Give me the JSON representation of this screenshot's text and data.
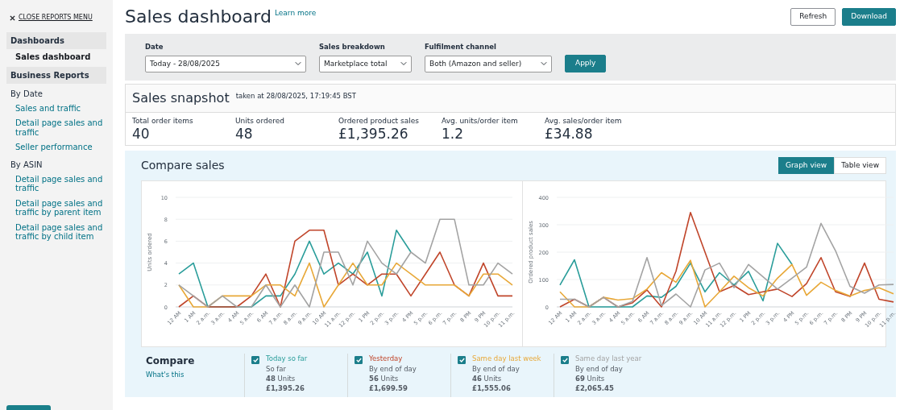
{
  "sidebar": {
    "close_label": "CLOSE REPORTS MENU",
    "items": [
      {
        "kind": "header",
        "label": "Dashboards"
      },
      {
        "kind": "link",
        "label": "Sales dashboard",
        "selected": true
      },
      {
        "kind": "header",
        "label": "Business Reports"
      },
      {
        "kind": "group",
        "label": "By Date"
      },
      {
        "kind": "link",
        "label": "Sales and traffic",
        "selected": false
      },
      {
        "kind": "link",
        "label": "Detail page sales and traffic",
        "selected": false
      },
      {
        "kind": "link",
        "label": "Seller performance",
        "selected": false
      },
      {
        "kind": "group",
        "label": "By ASIN"
      },
      {
        "kind": "link",
        "label": "Detail page sales and traffic",
        "selected": false
      },
      {
        "kind": "link",
        "label": "Detail page sales and traffic by parent item",
        "selected": false
      },
      {
        "kind": "link",
        "label": "Detail page sales and traffic by child item",
        "selected": false
      }
    ]
  },
  "header": {
    "title": "Sales dashboard",
    "learn_more": "Learn more",
    "buttons": [
      {
        "label": "Refresh",
        "kind": "secondary"
      },
      {
        "label": "Download",
        "kind": "primary"
      }
    ]
  },
  "filters": {
    "fields": [
      {
        "label": "Date",
        "value": "Today - 28/08/2025"
      },
      {
        "label": "Sales breakdown",
        "value": "Marketplace total"
      },
      {
        "label": "Fulfilment channel",
        "value": "Both (Amazon and seller)"
      }
    ],
    "apply": "Apply"
  },
  "snapshot": {
    "title": "Sales snapshot",
    "taken_at": "taken at 28/08/2025, 17:19:45 BST",
    "stats": [
      {
        "label": "Total order items",
        "value": "40"
      },
      {
        "label": "Units ordered",
        "value": "48"
      },
      {
        "label": "Ordered product sales",
        "value": "£1,395.26"
      },
      {
        "label": "Avg. units/order item",
        "value": "1.2"
      },
      {
        "label": "Avg. sales/order item",
        "value": "£34.88"
      }
    ]
  },
  "compare_sales": {
    "title": "Compare sales",
    "views": [
      {
        "label": "Graph view",
        "selected": true
      },
      {
        "label": "Table view",
        "selected": false
      }
    ],
    "charts": [
      {
        "chart_data": {
          "type": "line",
          "grid": true,
          "ylabel": "Units ordered",
          "categories": [
            "12 AM",
            "1 AM",
            "2 a.m.",
            "3 a.m.",
            "4 AM",
            "5 a.m.",
            "6 AM",
            "7 a.m.",
            "8 a.m.",
            "9 a.m.",
            "10 AM",
            "11 a.m.",
            "12 p.m.",
            "1 PM",
            "2 p.m.",
            "3 p.m.",
            "4 PM",
            "5 p.m.",
            "6 p.m.",
            "7 p.m.",
            "8 PM",
            "9 PM",
            "10 p.m.",
            "11 p.m."
          ],
          "ylim": [
            0,
            10
          ],
          "yticks": [
            0,
            2,
            4,
            6,
            8,
            10
          ],
          "series": [
            {
              "color": "#2a9d9a",
              "values": [
                3,
                4,
                0,
                0,
                0,
                0,
                1,
                1,
                3,
                6,
                3,
                4,
                3,
                5,
                1,
                7,
                5,
                null,
                null,
                null,
                null,
                null,
                null,
                null
              ]
            },
            {
              "color": "#c0452a",
              "values": [
                0,
                1,
                0,
                0,
                0,
                1,
                3,
                0,
                6,
                7,
                7,
                2,
                3,
                2,
                3,
                3,
                1,
                3,
                5,
                2,
                1,
                4,
                1,
                1
              ]
            },
            {
              "color": "#e8a838",
              "values": [
                2,
                0,
                0,
                1,
                1,
                1,
                2,
                2,
                1,
                4,
                0,
                2,
                4,
                2,
                2,
                4,
                3,
                2,
                2,
                2,
                1,
                3,
                3,
                2
              ]
            },
            {
              "color": "#a3a3a3",
              "values": [
                2,
                1,
                0,
                1,
                0,
                0,
                2,
                0,
                2,
                0,
                5,
                5,
                2,
                6,
                4,
                3,
                5,
                4,
                8,
                8,
                2,
                2,
                4,
                3
              ]
            }
          ]
        }
      },
      {
        "chart_data": {
          "type": "line",
          "grid": true,
          "ylabel": "Ordered product sales",
          "categories": [
            "12 AM",
            "1 AM",
            "2 a.m.",
            "3 a.m.",
            "4 AM",
            "5 a.m.",
            "6 AM",
            "7 a.m.",
            "8 a.m.",
            "9 a.m.",
            "10 AM",
            "11 a.m.",
            "12 p.m.",
            "1 PM",
            "2 p.m.",
            "3 p.m.",
            "4 PM",
            "5 p.m.",
            "6 p.m.",
            "7 p.m.",
            "8 PM",
            "9 PM",
            "10 p.m.",
            "11 p.m."
          ],
          "ylim": [
            0,
            400
          ],
          "yticks": [
            0,
            100,
            200,
            300,
            400
          ],
          "series": [
            {
              "color": "#2a9d9a",
              "values": [
                80,
                172,
                0,
                0,
                0,
                0,
                40,
                35,
                75,
                160,
                55,
                125,
                80,
                130,
                22,
                232,
                155,
                null,
                null,
                null,
                null,
                null,
                null,
                null
              ]
            },
            {
              "color": "#c0452a",
              "values": [
                0,
                28,
                0,
                35,
                0,
                15,
                62,
                0,
                130,
                345,
                200,
                55,
                78,
                45,
                55,
                65,
                38,
                85,
                180,
                55,
                38,
                160,
                28,
                18
              ]
            },
            {
              "color": "#e8a838",
              "values": [
                55,
                0,
                0,
                35,
                25,
                30,
                65,
                125,
                90,
                170,
                0,
                55,
                112,
                70,
                40,
                105,
                155,
                42,
                90,
                60,
                40,
                60,
                70,
                48
              ]
            },
            {
              "color": "#a3a3a3",
              "values": [
                28,
                28,
                0,
                35,
                0,
                20,
                180,
                5,
                47,
                0,
                135,
                160,
                70,
                155,
                110,
                65,
                105,
                145,
                305,
                205,
                75,
                50,
                80,
                82
              ]
            }
          ]
        }
      }
    ],
    "compare": {
      "title": "Compare",
      "help_link": "What's this",
      "items": [
        {
          "label": "Today so far",
          "checked": true,
          "period": "So far",
          "units": "**48** Units",
          "amount": "£1,395.26"
        },
        {
          "label": "Yesterday",
          "checked": true,
          "period": "By end of day",
          "units": "**56** Units",
          "amount": "£1,699.59"
        },
        {
          "label": "Same day last week",
          "checked": true,
          "period": "By end of day",
          "units": "**46** Units",
          "amount": "£1,555.06"
        },
        {
          "label": "Same day last year",
          "checked": true,
          "period": "By end of day",
          "units": "**69** Units",
          "amount": "£2,065.45"
        }
      ]
    }
  }
}
